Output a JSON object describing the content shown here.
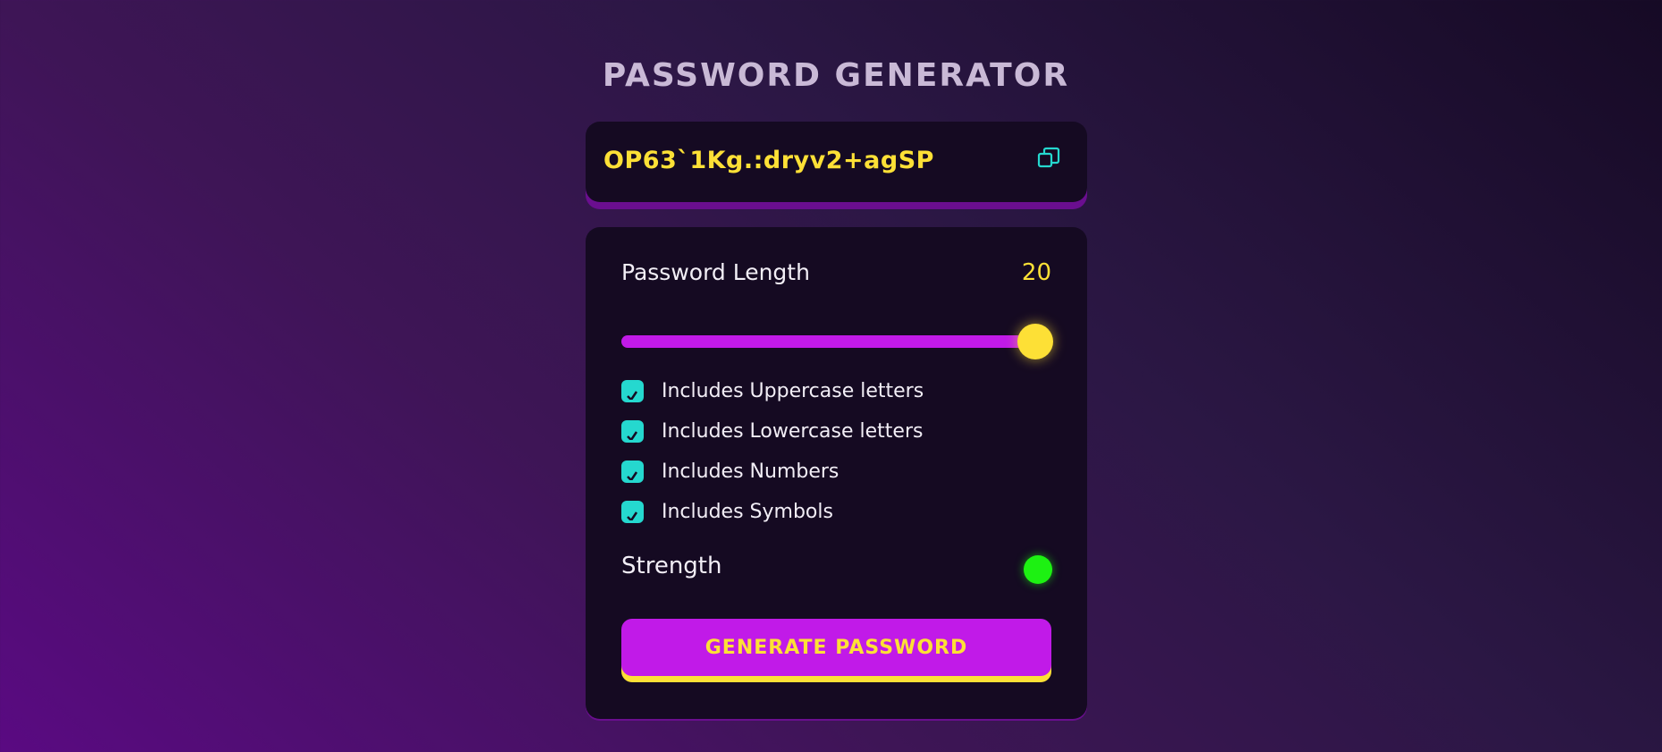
{
  "app": {
    "title": "PASSWORD GENERATOR"
  },
  "password": {
    "value": "OP63`1Kg.:dryv2+agSP",
    "copy_icon": "copy-icon"
  },
  "length": {
    "label": "Password Length",
    "value": "20",
    "min": 0,
    "max": 20,
    "current": 20
  },
  "options": [
    {
      "label": "Includes Uppercase letters",
      "checked": true
    },
    {
      "label": "Includes Lowercase letters",
      "checked": true
    },
    {
      "label": "Includes Numbers",
      "checked": true
    },
    {
      "label": "Includes Symbols",
      "checked": true
    }
  ],
  "strength": {
    "label": "Strength",
    "indicator_color": "#1df112"
  },
  "generate": {
    "label": "GENERATE PASSWORD"
  },
  "colors": {
    "accent": "#c11ae8",
    "highlight": "#fde036",
    "checkbox": "#25d8cf",
    "panel": "#150a22",
    "strength_strong": "#1df112"
  }
}
